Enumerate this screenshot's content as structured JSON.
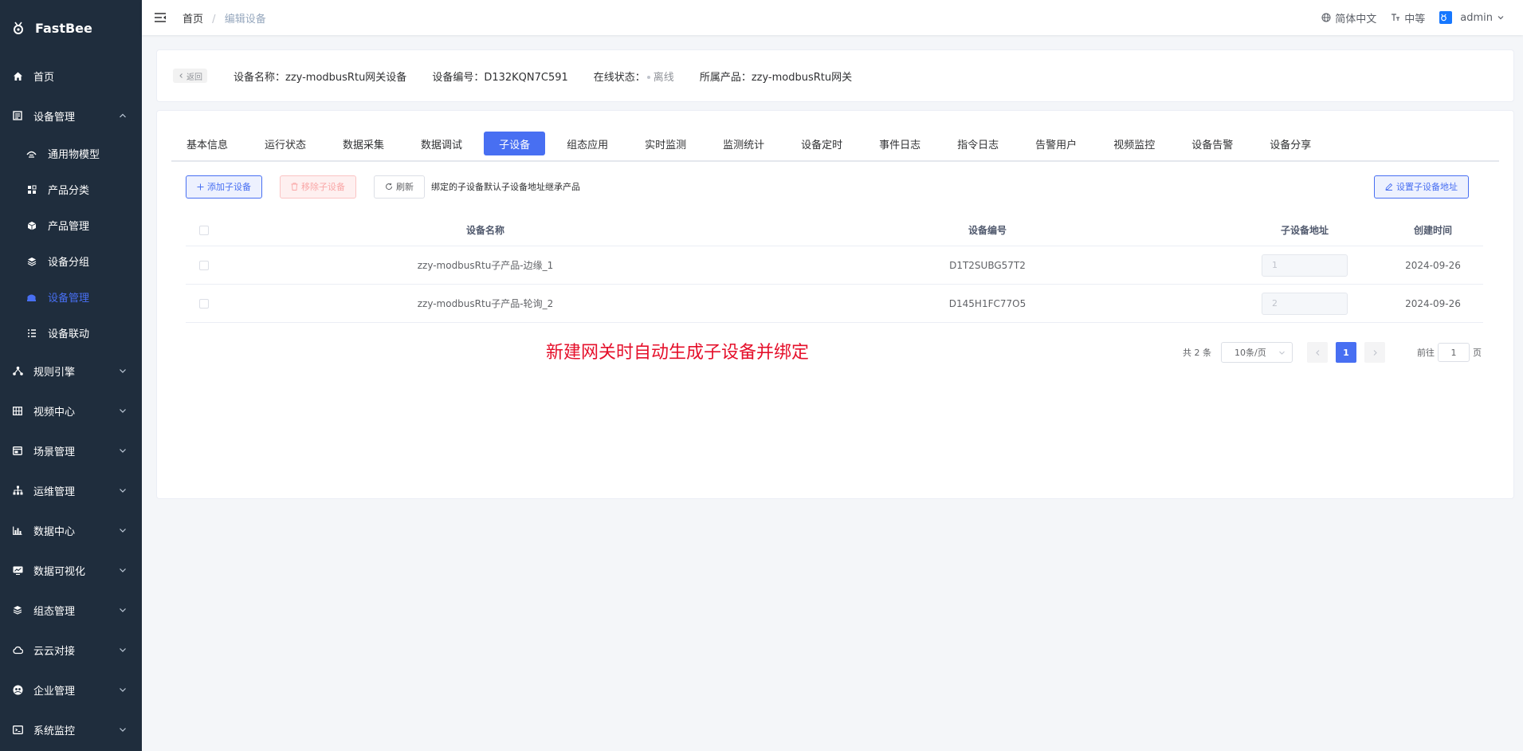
{
  "brand": {
    "name": "FastBee"
  },
  "sidebar": {
    "items": [
      {
        "label": "首页",
        "icon": "home-icon"
      },
      {
        "label": "设备管理",
        "icon": "device-list-icon",
        "expanded": true,
        "children": [
          {
            "label": "通用物模型",
            "icon": "model-icon"
          },
          {
            "label": "产品分类",
            "icon": "category-icon"
          },
          {
            "label": "产品管理",
            "icon": "product-box-icon"
          },
          {
            "label": "设备分组",
            "icon": "group-layers-icon"
          },
          {
            "label": "设备管理",
            "icon": "device-icon",
            "active": true
          },
          {
            "label": "设备联动",
            "icon": "linkage-icon"
          }
        ]
      },
      {
        "label": "规则引擎",
        "icon": "rule-engine-icon"
      },
      {
        "label": "视频中心",
        "icon": "video-grid-icon"
      },
      {
        "label": "场景管理",
        "icon": "scene-icon"
      },
      {
        "label": "运维管理",
        "icon": "ops-tree-icon"
      },
      {
        "label": "数据中心",
        "icon": "data-chart-icon"
      },
      {
        "label": "数据可视化",
        "icon": "visualize-icon"
      },
      {
        "label": "组态管理",
        "icon": "config-layers-icon"
      },
      {
        "label": "云云对接",
        "icon": "cloud-icon"
      },
      {
        "label": "企业管理",
        "icon": "enterprise-icon"
      },
      {
        "label": "系统监控",
        "icon": "monitor-icon"
      }
    ]
  },
  "topbar": {
    "breadcrumb": {
      "home": "首页",
      "sep": "/",
      "current": "编辑设备"
    },
    "language": "简体中文",
    "size": "中等",
    "user": "admin"
  },
  "header": {
    "back": "返回",
    "device_name": "设备名称：zzy-modbusRtu网关设备",
    "device_code": "设备编号：D132KQN7C591",
    "status_label": "在线状态：",
    "status_value": "离线",
    "product": "所属产品：zzy-modbusRtu网关"
  },
  "tabs": [
    {
      "label": "基本信息"
    },
    {
      "label": "运行状态"
    },
    {
      "label": "数据采集"
    },
    {
      "label": "数据调试"
    },
    {
      "label": "子设备",
      "active": true
    },
    {
      "label": "组态应用"
    },
    {
      "label": "实时监测"
    },
    {
      "label": "监测统计"
    },
    {
      "label": "设备定时"
    },
    {
      "label": "事件日志"
    },
    {
      "label": "指令日志"
    },
    {
      "label": "告警用户"
    },
    {
      "label": "视频监控"
    },
    {
      "label": "设备告警"
    },
    {
      "label": "设备分享"
    }
  ],
  "toolbar": {
    "add": "添加子设备",
    "remove": "移除子设备",
    "refresh": "刷新",
    "tip": "绑定的子设备默认子设备地址继承产品",
    "set_address": "设置子设备地址"
  },
  "table": {
    "columns": {
      "name": "设备名称",
      "code": "设备编号",
      "addr": "子设备地址",
      "time": "创建时间"
    },
    "rows": [
      {
        "name": "zzy-modbusRtu子产品-边缘_1",
        "code": "D1T2SUBG57T2",
        "addr": "1",
        "time": "2024-09-26"
      },
      {
        "name": "zzy-modbusRtu子产品-轮询_2",
        "code": "D145H1FC77O5",
        "addr": "2",
        "time": "2024-09-26"
      }
    ]
  },
  "annotation": "新建网关时自动生成子设备并绑定",
  "pager": {
    "total": "共 2 条",
    "page_size": "10条/页",
    "current": "1",
    "goto_prefix": "前往",
    "goto_value": "1",
    "goto_suffix": "页"
  },
  "colors": {
    "primary": "#486ff2",
    "sidebar_bg": "#1f2d3d",
    "annotation": "#e5102b"
  }
}
